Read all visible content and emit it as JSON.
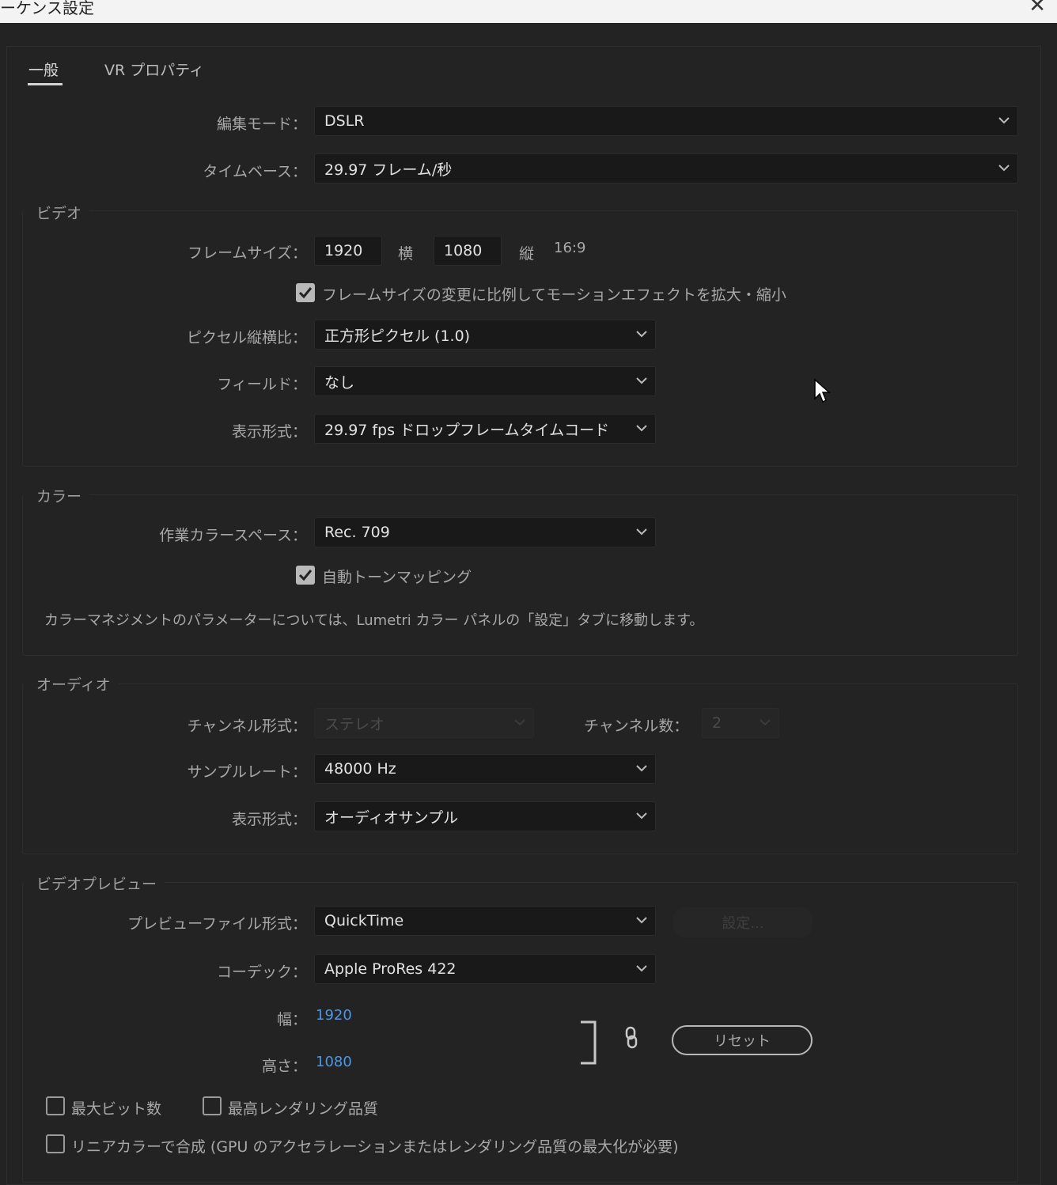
{
  "window": {
    "title": "ーケンス設定",
    "close_glyph": "✕"
  },
  "tabs": [
    {
      "label": "一般",
      "active": true
    },
    {
      "label": "VR プロパティ",
      "active": false
    }
  ],
  "general": {
    "edit_mode_label": "編集モード：",
    "edit_mode_value": "DSLR",
    "timebase_label": "タイムベース：",
    "timebase_value": "29.97  フレーム/秒"
  },
  "video": {
    "group_title": "ビデオ",
    "frame_size_label": "フレームサイズ：",
    "frame_width": "1920",
    "horizontal_label": "横",
    "frame_height": "1080",
    "vertical_label": "縦",
    "aspect": "16:9",
    "scale_motion_label": "フレームサイズの変更に比例してモーションエフェクトを拡大・縮小",
    "scale_motion_checked": true,
    "pixel_aspect_label": "ピクセル縦横比：",
    "pixel_aspect_value": "正方形ピクセル (1.0)",
    "fields_label": "フィールド：",
    "fields_value": "なし",
    "display_format_label": "表示形式：",
    "display_format_value": "29.97 fps ドロップフレームタイムコード"
  },
  "color": {
    "group_title": "カラー",
    "working_space_label": "作業カラースペース：",
    "working_space_value": "Rec. 709",
    "auto_tone_label": "自動トーンマッピング",
    "auto_tone_checked": true,
    "note": "カラーマネジメントのパラメーターについては、Lumetri カラー パネルの「設定」タブに移動します。"
  },
  "audio": {
    "group_title": "オーディオ",
    "channel_format_label": "チャンネル形式：",
    "channel_format_value": "ステレオ",
    "channel_count_label": "チャンネル数：",
    "channel_count_value": "2",
    "sample_rate_label": "サンプルレート：",
    "sample_rate_value": "48000 Hz",
    "display_format_label": "表示形式：",
    "display_format_value": "オーディオサンプル"
  },
  "preview": {
    "group_title": "ビデオプレビュー",
    "file_format_label": "プレビューファイル形式：",
    "file_format_value": "QuickTime",
    "settings_button": "設定...",
    "codec_label": "コーデック：",
    "codec_value": "Apple ProRes 422",
    "width_label": "幅：",
    "width_value": "1920",
    "height_label": "高さ：",
    "height_value": "1080",
    "reset_button": "リセット",
    "max_bit_depth_label": "最大ビット数",
    "max_render_quality_label": "最高レンダリング品質",
    "linear_color_label": "リニアカラーで合成 (GPU のアクセラレーションまたはレンダリング品質の最大化が必要)"
  },
  "colors": {
    "accent_blue": "#4e96e6",
    "background": "#232323",
    "field_bg": "#191919"
  }
}
